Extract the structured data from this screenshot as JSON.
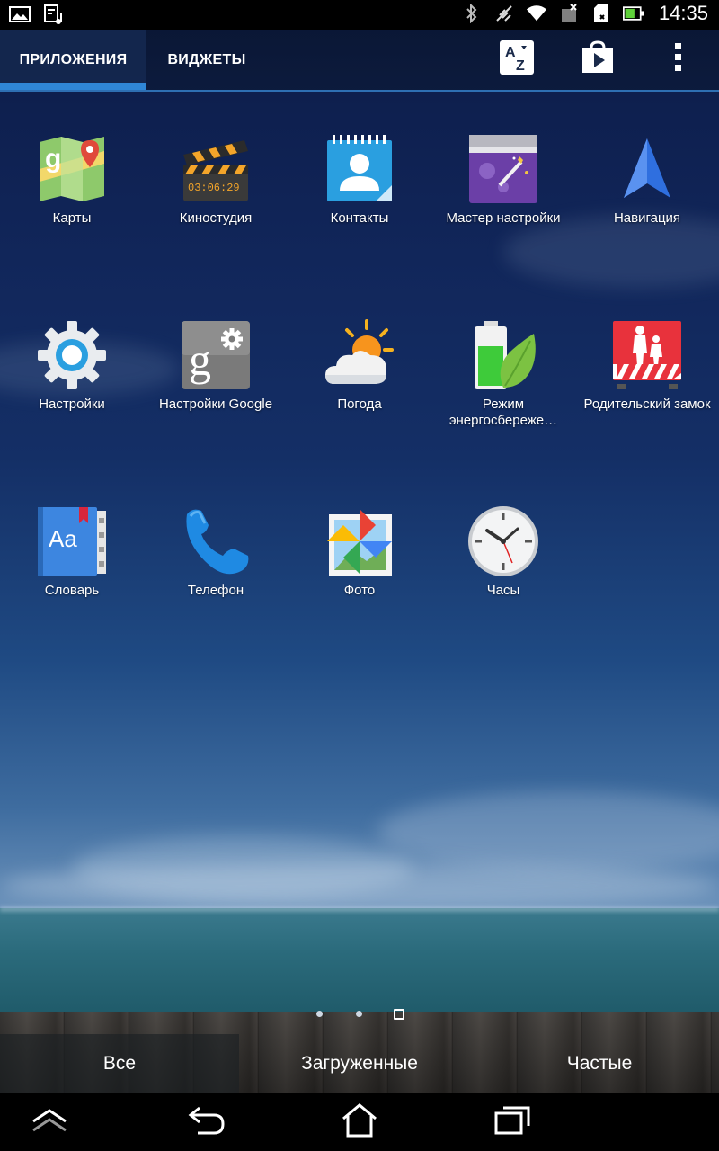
{
  "status_bar": {
    "time": "14:35",
    "left_icons": [
      "image-icon",
      "music-playlist-icon"
    ],
    "right_icons": [
      "bluetooth-icon",
      "no-signal-icon",
      "wifi-icon",
      "no-sim-icon",
      "sd-card-icon",
      "battery-icon"
    ]
  },
  "tabs": [
    {
      "label": "ПРИЛОЖЕНИЯ",
      "active": true
    },
    {
      "label": "ВИДЖЕТЫ",
      "active": false
    }
  ],
  "toolbar": {
    "sort_icon": "sort-az-icon",
    "store_icon": "play-store-icon",
    "menu_icon": "overflow-menu-icon"
  },
  "apps": [
    {
      "label": "Карты",
      "icon": "maps-icon"
    },
    {
      "label": "Киностудия",
      "icon": "movie-studio-icon"
    },
    {
      "label": "Контакты",
      "icon": "contacts-icon"
    },
    {
      "label": "Мастер настройки",
      "icon": "setup-wizard-icon"
    },
    {
      "label": "Навигация",
      "icon": "navigation-icon"
    },
    {
      "label": "Настройки",
      "icon": "settings-gear-icon"
    },
    {
      "label": "Настройки Google",
      "icon": "google-settings-icon"
    },
    {
      "label": "Погода",
      "icon": "weather-icon"
    },
    {
      "label": "Режим энергосбереже…",
      "icon": "power-saving-icon"
    },
    {
      "label": "Родительский замок",
      "icon": "parental-lock-icon"
    },
    {
      "label": "Словарь",
      "icon": "dictionary-icon"
    },
    {
      "label": "Телефон",
      "icon": "phone-icon"
    },
    {
      "label": "Фото",
      "icon": "photos-icon"
    },
    {
      "label": "Часы",
      "icon": "clock-icon"
    }
  ],
  "page_indicator": {
    "count": 3,
    "current": 3
  },
  "filters": [
    {
      "label": "Все",
      "active": true
    },
    {
      "label": "Загруженные",
      "active": false
    },
    {
      "label": "Частые",
      "active": false
    }
  ],
  "nav_bar": [
    "recent-up-icon",
    "back-icon",
    "home-icon",
    "recent-apps-icon"
  ],
  "colors": {
    "accent": "#2f86d6",
    "status_bar": "#000000",
    "battery": "#5fd13a"
  }
}
